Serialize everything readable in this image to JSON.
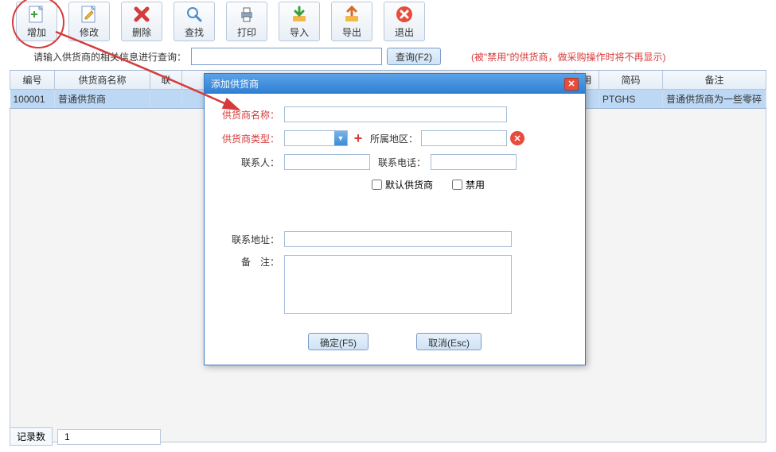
{
  "toolbar": {
    "add": "增加",
    "edit": "修改",
    "delete": "删除",
    "search": "查找",
    "print": "打印",
    "import": "导入",
    "export": "导出",
    "exit": "退出"
  },
  "search": {
    "label": "请输入供货商的相关信息进行查询：",
    "button": "查询(F2)",
    "hint": "(被\"禁用\"的供货商，做采购操作时将不再显示)"
  },
  "table": {
    "headers": {
      "code": "编号",
      "name": "供货商名称",
      "contact": "联",
      "disabled": "用",
      "pinyin": "简码",
      "remark": "备注"
    },
    "rows": [
      {
        "code": "100001",
        "name": "普通供货商",
        "pinyin": "PTGHS",
        "remark": "普通供货商为一些零碎"
      }
    ]
  },
  "status": {
    "label": "记录数",
    "value": "1"
  },
  "dialog": {
    "title": "添加供货商",
    "fields": {
      "name": "供货商名称：",
      "type": "供货商类型：",
      "region": "所属地区：",
      "contact": "联系人：",
      "phone": "联系电话：",
      "default_supplier": "默认供货商",
      "disabled": "禁用",
      "address": "联系地址：",
      "remark": "备　注："
    },
    "buttons": {
      "ok": "确定(F5)",
      "cancel": "取消(Esc)"
    }
  }
}
